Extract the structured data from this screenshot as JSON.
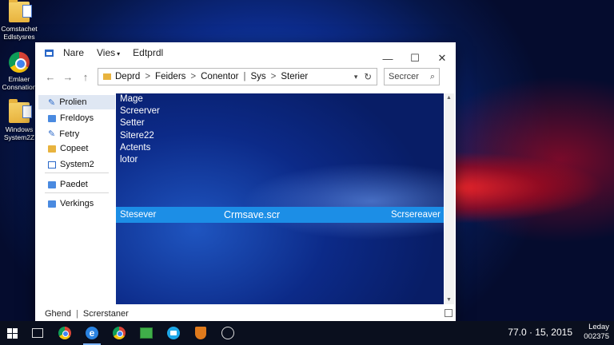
{
  "desktop": {
    "icons": [
      {
        "label": "Comstachet\nEdlstysres",
        "icon": "folder-icon"
      },
      {
        "label": "Emlaer\nConsnation",
        "icon": "chrome-icon"
      },
      {
        "label": "Windows\nSystem2Z",
        "icon": "folder-icon"
      }
    ]
  },
  "window": {
    "menu": [
      {
        "label": "Nare",
        "caret": ""
      },
      {
        "label": "Vies",
        "caret": "▾"
      },
      {
        "label": "Edtprdl",
        "caret": ""
      }
    ],
    "controls": {
      "minimize": "—",
      "maximize": "☐",
      "close": "✕"
    },
    "nav": {
      "back": "←",
      "forward": "→",
      "up": "↑"
    },
    "address": {
      "crumbs": [
        "Deprd",
        "Feiders",
        "Conentor",
        "Sys",
        "Sterier"
      ],
      "separators": [
        ">",
        ">",
        "|",
        ">"
      ],
      "dropdown": "▾",
      "refresh": "↻"
    },
    "search": {
      "placeholder": "Secrcer",
      "icon": "⌕"
    },
    "sidebar": {
      "items": [
        {
          "label": "Prolien",
          "icon": "pin-icon",
          "active": true
        },
        {
          "label": "Freldoys",
          "icon": "pin-icon"
        },
        {
          "label": "Fetry",
          "icon": "pin-icon"
        },
        {
          "label": "Copeet",
          "icon": "folder-icon"
        },
        {
          "label": "System2",
          "icon": "document-icon"
        },
        {
          "label": "Paedet",
          "icon": "folder-icon"
        },
        {
          "label": "Verkings",
          "icon": "network-icon"
        }
      ]
    },
    "files": [
      "Mage",
      "Screerver",
      "Setter",
      "Sitere22",
      "Actents",
      "lotor"
    ],
    "selected_file": {
      "name": "Stesever",
      "filename": "Crmsave.scr",
      "type": "Scrsereaver"
    },
    "statusbar": {
      "left": "Ghend",
      "right": "Screrstaner"
    }
  },
  "taskbar": {
    "edge_glyph": "e",
    "time": "77.0 · 15, 2015",
    "date": "Leday\n002375"
  },
  "colors": {
    "selection": "#1c8ee6",
    "accent": "#2a68c8",
    "taskbar": "#0a0f1e"
  }
}
